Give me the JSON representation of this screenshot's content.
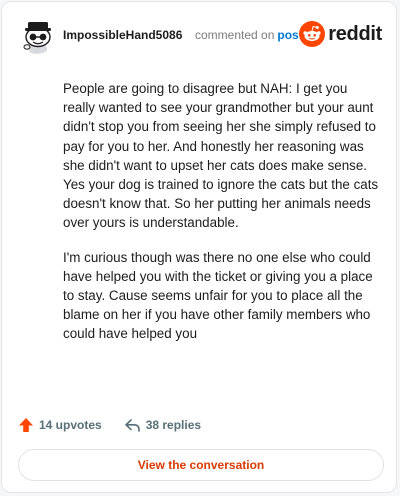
{
  "comment": {
    "username": "ImpossibleHand5086",
    "meta_text": "commented on",
    "post_link": "post",
    "brand": "reddit",
    "paragraphs": [
      "People are going to disagree but NAH: I get you really wanted to see your grandmother but your aunt didn't stop you from seeing her she simply refused to pay for you to her. And honestly her reasoning was she didn't want to upset her cats does make sense. Yes your dog is trained to ignore the cats but the cats doesn't know that. So her putting her animals needs over yours is understandable.",
      "I'm curious though was there no one else who could have helped you with the ticket or giving you a place to stay. Cause seems unfair for you to place all the blame on her if you have other family members who could have helped you"
    ]
  },
  "actions": {
    "upvotes": "14 upvotes",
    "replies": "38 replies"
  },
  "cta": {
    "label": "View the conversation"
  },
  "colors": {
    "brand_orange": "#ff4500",
    "link_blue": "#0079d3",
    "cta_text": "#d93a00",
    "muted": "#576f76"
  },
  "icons": {
    "avatar": "snoo-avatar-icon",
    "logo": "reddit-logo-icon",
    "upvote": "upvote-arrow-icon",
    "reply": "reply-arrow-icon"
  }
}
